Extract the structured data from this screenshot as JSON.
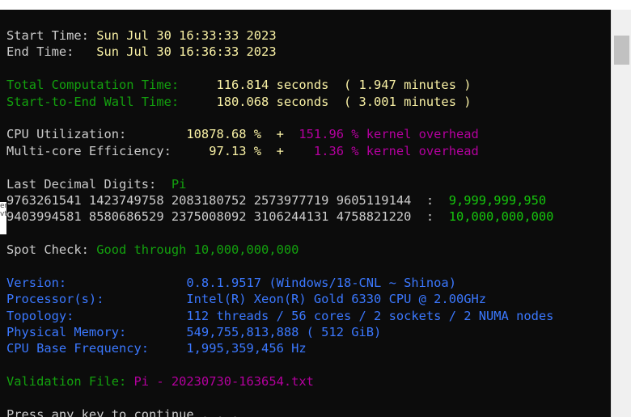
{
  "terminal": {
    "lines": [
      {
        "segments": [
          {
            "text": "Start Time: ",
            "color": "white"
          },
          {
            "text": "Sun Jul 30 16:33:33 2023",
            "color": "yellow"
          }
        ]
      },
      {
        "segments": [
          {
            "text": "End Time:   ",
            "color": "white"
          },
          {
            "text": "Sun Jul 30 16:36:33 2023",
            "color": "yellow"
          }
        ]
      },
      {
        "segments": [
          {
            "text": "",
            "color": "white"
          }
        ]
      },
      {
        "segments": [
          {
            "text": "Total Computation Time:     ",
            "color": "green"
          },
          {
            "text": "116.814 seconds  ( 1.947 minutes )",
            "color": "yellow"
          }
        ]
      },
      {
        "segments": [
          {
            "text": "Start-to-End Wall Time:     ",
            "color": "green"
          },
          {
            "text": "180.068 seconds  ( 3.001 minutes )",
            "color": "yellow"
          }
        ]
      },
      {
        "segments": [
          {
            "text": "",
            "color": "white"
          }
        ]
      },
      {
        "segments": [
          {
            "text": "CPU Utilization:        ",
            "color": "white"
          },
          {
            "text": "10878.68 %  +  ",
            "color": "yellow"
          },
          {
            "text": "151.96 % kernel overhead",
            "color": "magenta"
          }
        ]
      },
      {
        "segments": [
          {
            "text": "Multi-core Efficiency:     ",
            "color": "white"
          },
          {
            "text": "97.13 %  +    ",
            "color": "yellow"
          },
          {
            "text": "1.36 % kernel overhead",
            "color": "magenta"
          }
        ]
      },
      {
        "segments": [
          {
            "text": "",
            "color": "white"
          }
        ]
      },
      {
        "segments": [
          {
            "text": "Last Decimal Digits:  ",
            "color": "white"
          },
          {
            "text": "Pi",
            "color": "green"
          }
        ]
      },
      {
        "segments": [
          {
            "text": "9763261541 1423749758 2083180752 2573977719 9605119144  :  ",
            "color": "white"
          },
          {
            "text": "9,999,999,950",
            "color": "bgreen"
          }
        ]
      },
      {
        "segments": [
          {
            "text": "9403994581 8580686529 2375008092 3106244131 4758821220  :  ",
            "color": "white"
          },
          {
            "text": "10,000,000,000",
            "color": "bgreen"
          }
        ]
      },
      {
        "segments": [
          {
            "text": "",
            "color": "white"
          }
        ]
      },
      {
        "segments": [
          {
            "text": "Spot Check: ",
            "color": "white"
          },
          {
            "text": "Good through 10,000,000,000",
            "color": "green"
          }
        ]
      },
      {
        "segments": [
          {
            "text": "",
            "color": "white"
          }
        ]
      },
      {
        "segments": [
          {
            "text": "Version:                ",
            "color": "blue"
          },
          {
            "text": "0.8.1.9517 (Windows/18-CNL ~ Shinoa)",
            "color": "blue"
          }
        ]
      },
      {
        "segments": [
          {
            "text": "Processor(s):           ",
            "color": "blue"
          },
          {
            "text": "Intel(R) Xeon(R) Gold 6330 CPU @ 2.00GHz",
            "color": "blue"
          }
        ]
      },
      {
        "segments": [
          {
            "text": "Topology:               ",
            "color": "blue"
          },
          {
            "text": "112 threads / 56 cores / 2 sockets / 2 NUMA nodes",
            "color": "blue"
          }
        ]
      },
      {
        "segments": [
          {
            "text": "Physical Memory:        ",
            "color": "blue"
          },
          {
            "text": "549,755,813,888 ( 512 GiB)",
            "color": "blue"
          }
        ]
      },
      {
        "segments": [
          {
            "text": "CPU Base Frequency:     ",
            "color": "blue"
          },
          {
            "text": "1,995,359,456 Hz",
            "color": "blue"
          }
        ]
      },
      {
        "segments": [
          {
            "text": "",
            "color": "white"
          }
        ]
      },
      {
        "segments": [
          {
            "text": "Validation File: ",
            "color": "green"
          },
          {
            "text": "Pi - 20230730-163654.txt",
            "color": "magenta"
          }
        ]
      },
      {
        "segments": [
          {
            "text": "",
            "color": "white"
          }
        ]
      },
      {
        "segments": [
          {
            "text": "Press any key to continue . . .",
            "color": "white"
          }
        ]
      }
    ]
  },
  "edge_text": "er\nvt"
}
